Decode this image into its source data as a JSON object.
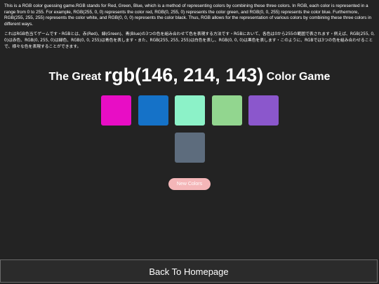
{
  "intro": {
    "english": "This is a RGB color guessing game.RGB stands for Red, Green, Blue, which is a method of representing colors by combining these three colors. In RGB, each color is represented in a range from 0 to 255. For example, RGB(255, 0, 0) represents the color red, RGB(0, 255, 0) represents the color green, and RGB(0, 0, 255) represents the color blue. Furthermore, RGB(255, 255, 255) represents the color white, and RGB(0, 0, 0) represents the color black. Thus, RGB allows for the representation of various colors by combining these three colors in different ways.",
    "japanese": "これはRGB色当てゲームです・RGBとは、赤(Red)、緑(Green)、青(Blue)の3つの色を組み合わせて色を表現する方法です・RGBにおいて、各色は0から255の範囲で表されます・例えば、RGB(255, 0, 0)は赤色、RGB(0, 255, 0)は緑色、RGB(0, 0, 255)は青色を表します・また、RGB(255, 255, 255)は白色を表し、RGB(0, 0, 0)は黒色を表します・このように、RGBでは3つの色を組み合わせることで、様々な色を表現することができます。"
  },
  "title": {
    "prefix": "The Great",
    "target": "rgb(146, 214, 143)",
    "suffix": "Color Game"
  },
  "squares": [
    {
      "color": "#e80dc5"
    },
    {
      "color": "#1572c8"
    },
    {
      "color": "#8cf2c8"
    },
    {
      "color": "#92d68f"
    },
    {
      "color": "#8b57cc"
    },
    {
      "color": "#5d6c7d"
    }
  ],
  "buttons": {
    "new_colors": "New Colors",
    "back": "Back To Homepage"
  }
}
